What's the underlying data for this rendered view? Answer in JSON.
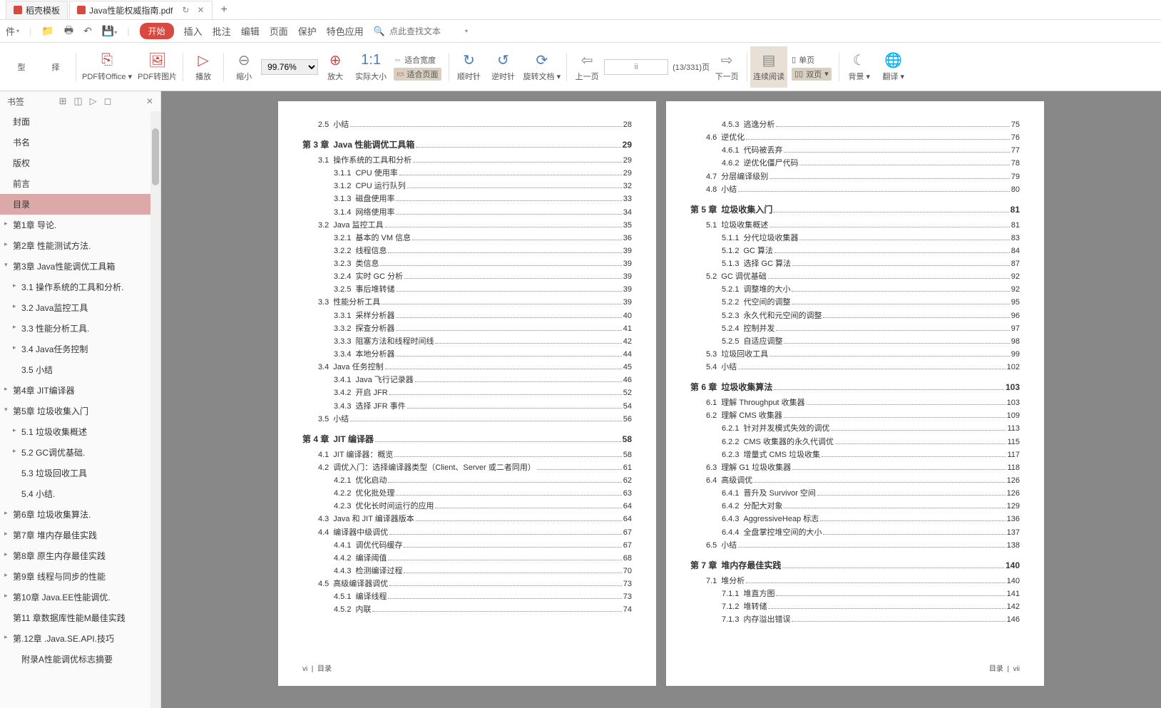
{
  "tabs": {
    "t1": "稻壳模板",
    "t2": "Java性能权威指南.pdf",
    "restore": "↻"
  },
  "menu": {
    "start": "开始",
    "insert": "插入",
    "review": "批注",
    "edit": "编辑",
    "page": "页面",
    "protect": "保护",
    "special": "特色应用",
    "search_ph": "点此查找文本"
  },
  "tools": {
    "type": "型",
    "select": "择",
    "pdf2office": "PDF转Office",
    "pdf2pic": "PDF转图片",
    "play": "播放",
    "zoomout": "缩小",
    "zoomval": "99.76%",
    "zoomin": "放大",
    "fitreal": "实际大小",
    "fitwidth": "适合宽度",
    "fitpage": "适合页面",
    "cw": "顺时针",
    "ccw": "逆时针",
    "rotate": "旋转文档",
    "prev": "上一页",
    "pageinfo": "(13/331)页",
    "pagecur": "ii",
    "next": "下一页",
    "continuous": "连续阅读",
    "single": "单页",
    "double": "双页",
    "bg": "背景",
    "translate": "翻译"
  },
  "side": {
    "title": "书签"
  },
  "bookmarks": [
    {
      "l": 0,
      "t": "封面"
    },
    {
      "l": 0,
      "t": "书名"
    },
    {
      "l": 0,
      "t": "版权"
    },
    {
      "l": 0,
      "t": "前言"
    },
    {
      "l": 0,
      "t": "目录",
      "sel": true
    },
    {
      "l": 0,
      "t": "第1章 导论.",
      "e": "▸"
    },
    {
      "l": 0,
      "t": "第2章 性能测试方法.",
      "e": "▸"
    },
    {
      "l": 0,
      "t": "第3章 Java性能调优工具箱",
      "e": "▾"
    },
    {
      "l": 1,
      "t": "3.1 操作系统的工具和分析.",
      "e": "▸"
    },
    {
      "l": 1,
      "t": "3.2 Java监控工具",
      "e": "▸"
    },
    {
      "l": 1,
      "t": "3.3 性能分析工具.",
      "e": "▸"
    },
    {
      "l": 1,
      "t": "3.4 Java任务控制",
      "e": "▸"
    },
    {
      "l": 1,
      "t": "3.5 小结"
    },
    {
      "l": 0,
      "t": "第4章 JIT编译器",
      "e": "▸"
    },
    {
      "l": 0,
      "t": "第5章 垃圾收集入门",
      "e": "▾"
    },
    {
      "l": 1,
      "t": "5.1 垃圾收集概述",
      "e": "▸"
    },
    {
      "l": 1,
      "t": "5.2 GC调优基础.",
      "e": "▸"
    },
    {
      "l": 1,
      "t": "5.3 垃圾回收工具"
    },
    {
      "l": 1,
      "t": "5.4 小结."
    },
    {
      "l": 0,
      "t": "第6章 垃圾收集算法.",
      "e": "▸"
    },
    {
      "l": 0,
      "t": "第7章 堆内存最佳实践",
      "e": "▸"
    },
    {
      "l": 0,
      "t": "第8章 原生内存最佳实践",
      "e": "▸"
    },
    {
      "l": 0,
      "t": "第9章 线程与同步的性能",
      "e": "▸"
    },
    {
      "l": 0,
      "t": "第10章 Java.EE性能调优.",
      "e": "▸"
    },
    {
      "l": 0,
      "t": "第11 章数据库性能M最佳实践",
      "e": ""
    },
    {
      "l": 0,
      "t": "第.12章 .Java.SE.API.技巧",
      "e": "▸"
    },
    {
      "l": 1,
      "t": "附录A性能调优标志摘要"
    }
  ],
  "left_toc": [
    {
      "cls": "section",
      "n": "2.5",
      "t": "小结",
      "p": "28"
    },
    {
      "cls": "chapter",
      "n": "第 3 章",
      "t": "Java 性能调优工具箱",
      "p": "29"
    },
    {
      "cls": "section",
      "n": "3.1",
      "t": "操作系统的工具和分析",
      "p": "29"
    },
    {
      "cls": "sub",
      "n": "3.1.1",
      "t": "CPU 使用率",
      "p": "29"
    },
    {
      "cls": "sub",
      "n": "3.1.2",
      "t": "CPU 运行队列",
      "p": "32"
    },
    {
      "cls": "sub",
      "n": "3.1.3",
      "t": "磁盘使用率",
      "p": "33"
    },
    {
      "cls": "sub",
      "n": "3.1.4",
      "t": "网络使用率",
      "p": "34"
    },
    {
      "cls": "section",
      "n": "3.2",
      "t": "Java 监控工具",
      "p": "35"
    },
    {
      "cls": "sub",
      "n": "3.2.1",
      "t": "基本的 VM 信息",
      "p": "36"
    },
    {
      "cls": "sub",
      "n": "3.2.2",
      "t": "线程信息",
      "p": "39"
    },
    {
      "cls": "sub",
      "n": "3.2.3",
      "t": "类信息",
      "p": "39"
    },
    {
      "cls": "sub",
      "n": "3.2.4",
      "t": "实时 GC 分析",
      "p": "39"
    },
    {
      "cls": "sub",
      "n": "3.2.5",
      "t": "事后堆转储",
      "p": "39"
    },
    {
      "cls": "section",
      "n": "3.3",
      "t": "性能分析工具",
      "p": "39"
    },
    {
      "cls": "sub",
      "n": "3.3.1",
      "t": "采样分析器",
      "p": "40"
    },
    {
      "cls": "sub",
      "n": "3.3.2",
      "t": "探查分析器",
      "p": "41"
    },
    {
      "cls": "sub",
      "n": "3.3.3",
      "t": "阻塞方法和线程时间线",
      "p": "42"
    },
    {
      "cls": "sub",
      "n": "3.3.4",
      "t": "本地分析器",
      "p": "44"
    },
    {
      "cls": "section",
      "n": "3.4",
      "t": "Java 任务控制",
      "p": "45"
    },
    {
      "cls": "sub",
      "n": "3.4.1",
      "t": "Java 飞行记录器",
      "p": "46"
    },
    {
      "cls": "sub",
      "n": "3.4.2",
      "t": "开启 JFR",
      "p": "52"
    },
    {
      "cls": "sub",
      "n": "3.4.3",
      "t": "选择 JFR 事件",
      "p": "54"
    },
    {
      "cls": "section",
      "n": "3.5",
      "t": "小结",
      "p": "56"
    },
    {
      "cls": "chapter",
      "n": "第 4 章",
      "t": "JIT 编译器",
      "p": "58"
    },
    {
      "cls": "section",
      "n": "4.1",
      "t": "JIT 编译器：概览",
      "p": "58"
    },
    {
      "cls": "section",
      "n": "4.2",
      "t": "调优入门：选择编译器类型（Client、Server 或二者同用）",
      "p": "61"
    },
    {
      "cls": "sub",
      "n": "4.2.1",
      "t": "优化启动",
      "p": "62"
    },
    {
      "cls": "sub",
      "n": "4.2.2",
      "t": "优化批处理",
      "p": "63"
    },
    {
      "cls": "sub",
      "n": "4.2.3",
      "t": "优化长时间运行的应用",
      "p": "64"
    },
    {
      "cls": "section",
      "n": "4.3",
      "t": "Java 和 JIT 编译器版本",
      "p": "64"
    },
    {
      "cls": "section",
      "n": "4.4",
      "t": "编译器中级调优",
      "p": "67"
    },
    {
      "cls": "sub",
      "n": "4.4.1",
      "t": "调优代码缓存",
      "p": "67"
    },
    {
      "cls": "sub",
      "n": "4.4.2",
      "t": "编译阈值",
      "p": "68"
    },
    {
      "cls": "sub",
      "n": "4.4.3",
      "t": "检测编译过程",
      "p": "70"
    },
    {
      "cls": "section",
      "n": "4.5",
      "t": "高级编译器调优",
      "p": "73"
    },
    {
      "cls": "sub",
      "n": "4.5.1",
      "t": "编译线程",
      "p": "73"
    },
    {
      "cls": "sub",
      "n": "4.5.2",
      "t": "内联",
      "p": "74"
    }
  ],
  "right_toc": [
    {
      "cls": "sub",
      "n": "4.5.3",
      "t": "逃逸分析",
      "p": "75"
    },
    {
      "cls": "section",
      "n": "4.6",
      "t": "逆优化",
      "p": "76"
    },
    {
      "cls": "sub",
      "n": "4.6.1",
      "t": "代码被丢弃",
      "p": "77"
    },
    {
      "cls": "sub",
      "n": "4.6.2",
      "t": "逆优化僵尸代码",
      "p": "78"
    },
    {
      "cls": "section",
      "n": "4.7",
      "t": "分层编译级别",
      "p": "79"
    },
    {
      "cls": "section",
      "n": "4.8",
      "t": "小结",
      "p": "80"
    },
    {
      "cls": "chapter",
      "n": "第 5 章",
      "t": "垃圾收集入门",
      "p": "81"
    },
    {
      "cls": "section",
      "n": "5.1",
      "t": "垃圾收集概述",
      "p": "81"
    },
    {
      "cls": "sub",
      "n": "5.1.1",
      "t": "分代垃圾收集器",
      "p": "83"
    },
    {
      "cls": "sub",
      "n": "5.1.2",
      "t": "GC 算法",
      "p": "84"
    },
    {
      "cls": "sub",
      "n": "5.1.3",
      "t": "选择 GC 算法",
      "p": "87"
    },
    {
      "cls": "section",
      "n": "5.2",
      "t": "GC 调优基础",
      "p": "92"
    },
    {
      "cls": "sub",
      "n": "5.2.1",
      "t": "调整堆的大小",
      "p": "92"
    },
    {
      "cls": "sub",
      "n": "5.2.2",
      "t": "代空间的调整",
      "p": "95"
    },
    {
      "cls": "sub",
      "n": "5.2.3",
      "t": "永久代和元空间的调整",
      "p": "96"
    },
    {
      "cls": "sub",
      "n": "5.2.4",
      "t": "控制并发",
      "p": "97"
    },
    {
      "cls": "sub",
      "n": "5.2.5",
      "t": "自适应调整",
      "p": "98"
    },
    {
      "cls": "section",
      "n": "5.3",
      "t": "垃圾回收工具",
      "p": "99"
    },
    {
      "cls": "section",
      "n": "5.4",
      "t": "小结",
      "p": "102"
    },
    {
      "cls": "chapter",
      "n": "第 6 章",
      "t": "垃圾收集算法",
      "p": "103"
    },
    {
      "cls": "section",
      "n": "6.1",
      "t": "理解 Throughput 收集器",
      "p": "103"
    },
    {
      "cls": "section",
      "n": "6.2",
      "t": "理解 CMS 收集器",
      "p": "109"
    },
    {
      "cls": "sub",
      "n": "6.2.1",
      "t": "针对并发模式失效的调优",
      "p": "113"
    },
    {
      "cls": "sub",
      "n": "6.2.2",
      "t": "CMS 收集器的永久代调优",
      "p": "115"
    },
    {
      "cls": "sub",
      "n": "6.2.3",
      "t": "增量式 CMS 垃圾收集",
      "p": "117"
    },
    {
      "cls": "section",
      "n": "6.3",
      "t": "理解 G1 垃圾收集器",
      "p": "118"
    },
    {
      "cls": "section",
      "n": "6.4",
      "t": "高级调优",
      "p": "126"
    },
    {
      "cls": "sub",
      "n": "6.4.1",
      "t": "晋升及 Survivor 空间",
      "p": "126"
    },
    {
      "cls": "sub",
      "n": "6.4.2",
      "t": "分配大对象",
      "p": "129"
    },
    {
      "cls": "sub",
      "n": "6.4.3",
      "t": "AggressiveHeap 标志",
      "p": "136"
    },
    {
      "cls": "sub",
      "n": "6.4.4",
      "t": "全盘掌控堆空间的大小",
      "p": "137"
    },
    {
      "cls": "section",
      "n": "6.5",
      "t": "小结",
      "p": "138"
    },
    {
      "cls": "chapter",
      "n": "第 7 章",
      "t": "堆内存最佳实践",
      "p": "140"
    },
    {
      "cls": "section",
      "n": "7.1",
      "t": "堆分析",
      "p": "140"
    },
    {
      "cls": "sub",
      "n": "7.1.1",
      "t": "堆直方图",
      "p": "141"
    },
    {
      "cls": "sub",
      "n": "7.1.2",
      "t": "堆转储",
      "p": "142"
    },
    {
      "cls": "sub",
      "n": "7.1.3",
      "t": "内存溢出错误",
      "p": "146"
    }
  ],
  "footer": {
    "left_num": "vi",
    "left_label": "目录",
    "right_label": "目录",
    "right_num": "vii"
  }
}
